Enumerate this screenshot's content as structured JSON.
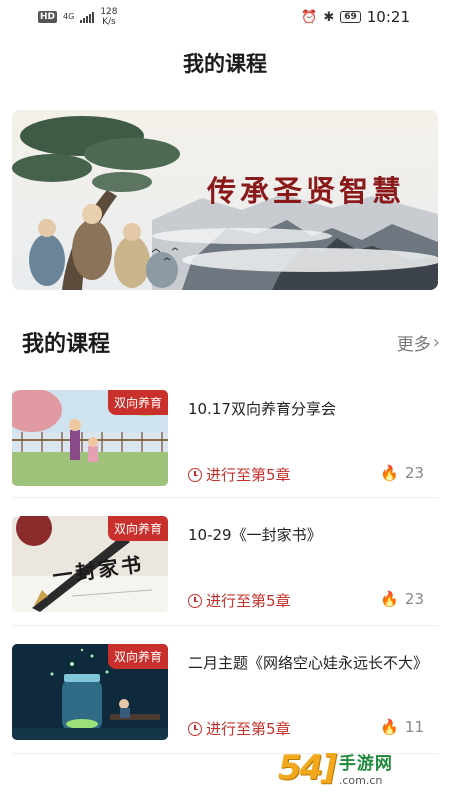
{
  "status_bar": {
    "hd": "HD",
    "signal": "4G",
    "speed_value": "128",
    "speed_unit": "K/s",
    "battery": "69",
    "time": "10:21"
  },
  "header": {
    "title": "我的课程"
  },
  "banner": {
    "text": "传承圣贤智慧"
  },
  "section": {
    "title": "我的课程",
    "more_label": "更多",
    "more_icon": "chevron-right-icon"
  },
  "courses": [
    {
      "badge": "双向养育",
      "title": "10.17双向养育分享会",
      "progress": "进行至第5章",
      "hot": "23"
    },
    {
      "badge": "双向养育",
      "title": "10-29《一封家书》",
      "progress": "进行至第5章",
      "hot": "23",
      "thumb_text": "一封家书"
    },
    {
      "badge": "双向养育",
      "title": "二月主题《网络空心娃永远长不大》",
      "progress": "进行至第5章",
      "hot": "11"
    }
  ],
  "watermark": {
    "num": "54]",
    "cn": "手游网",
    "en": ".com.cn"
  },
  "colors": {
    "accent": "#c9302c",
    "title": "#1a1a1a",
    "muted": "#888888"
  }
}
